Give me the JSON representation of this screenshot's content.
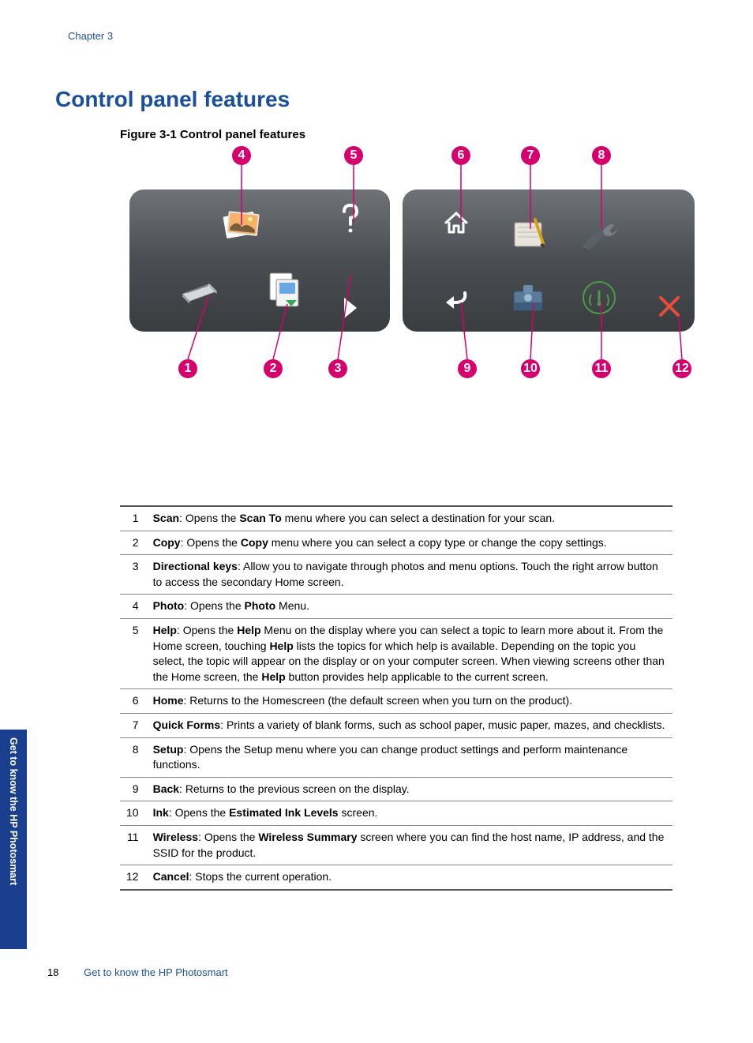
{
  "chapter": "Chapter 3",
  "heading": "Control panel features",
  "figure_caption": "Figure 3-1 Control panel features",
  "markers": [
    "1",
    "2",
    "3",
    "4",
    "5",
    "6",
    "7",
    "8",
    "9",
    "10",
    "11",
    "12"
  ],
  "table": [
    {
      "n": "1",
      "bold1": "Scan",
      "mid1": ": Opens the ",
      "bold2": "Scan To",
      "rest": " menu where you can select a destination for your scan."
    },
    {
      "n": "2",
      "bold1": "Copy",
      "mid1": ": Opens the ",
      "bold2": "Copy",
      "rest": " menu where you can select a copy type or change the copy settings."
    },
    {
      "n": "3",
      "bold1": "Directional keys",
      "mid1": "",
      "bold2": "",
      "rest": ": Allow you to navigate through photos and menu options. Touch the right arrow button to access the secondary Home screen."
    },
    {
      "n": "4",
      "bold1": "Photo",
      "mid1": ": Opens the ",
      "bold2": "Photo",
      "rest": " Menu."
    },
    {
      "n": "5",
      "bold1": "Help",
      "mid1": ": Opens the ",
      "bold2": "Help",
      "rest": " Menu on the display where you can select a topic to learn more about it. From the Home screen, touching ",
      "bold3": "Help",
      "rest2": " lists the topics for which help is available. Depending on the topic you select, the topic will appear on the display or on your computer screen. When viewing screens other than the Home screen, the ",
      "bold4": "Help",
      "rest3": " button provides help applicable to the current screen."
    },
    {
      "n": "6",
      "bold1": "Home",
      "mid1": "",
      "bold2": "",
      "rest": ": Returns to the Homescreen (the default screen when you turn on the product)."
    },
    {
      "n": "7",
      "bold1": "Quick Forms",
      "mid1": "",
      "bold2": "",
      "rest": ": Prints a variety of blank forms, such as school paper, music paper, mazes, and checklists."
    },
    {
      "n": "8",
      "bold1": "Setup",
      "mid1": "",
      "bold2": "",
      "rest": ": Opens the Setup menu where you can change product settings and perform maintenance functions."
    },
    {
      "n": "9",
      "bold1": "Back",
      "mid1": "",
      "bold2": "",
      "rest": ": Returns to the previous screen on the display."
    },
    {
      "n": "10",
      "bold1": "Ink",
      "mid1": ": Opens the ",
      "bold2": "Estimated Ink Levels",
      "rest": " screen."
    },
    {
      "n": "11",
      "bold1": "Wireless",
      "mid1": ": Opens the ",
      "bold2": "Wireless Summary",
      "rest": " screen where you can find the host name, IP address, and the SSID for the product."
    },
    {
      "n": "12",
      "bold1": "Cancel",
      "mid1": "",
      "bold2": "",
      "rest": ": Stops the current operation."
    }
  ],
  "side_tab": "Get to know the HP Photosmart",
  "footer_page": "18",
  "footer_text": "Get to know the HP Photosmart"
}
